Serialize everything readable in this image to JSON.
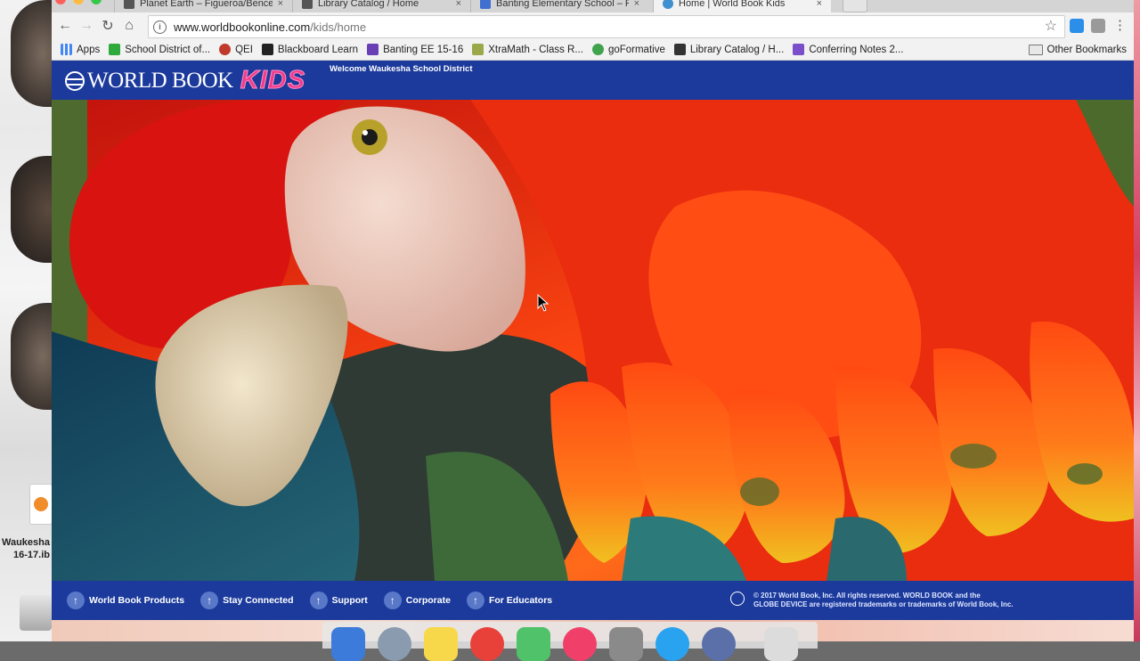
{
  "desktop": {
    "file_label_line1": "Waukesha",
    "file_label_line2": "16-17.ib"
  },
  "browser": {
    "tabs": [
      {
        "title": "Planet Earth – Figueroa/Bence",
        "active": false
      },
      {
        "title": "Library Catalog / Home",
        "active": false
      },
      {
        "title": "Banting Elementary School – F",
        "active": false
      },
      {
        "title": "Home | World Book Kids",
        "active": true
      }
    ],
    "tab_close_glyph": "×",
    "address": {
      "host": "www.worldbookonline.com",
      "path": "/kids/home"
    },
    "bookmarks": [
      {
        "label": "Apps",
        "icon": "apps-grid-icon",
        "color": "#4285f4"
      },
      {
        "label": "School District of...",
        "icon": "school-district-icon",
        "color": "#2eaa3d"
      },
      {
        "label": "QEI",
        "icon": "qei-icon",
        "color": "#c0392b"
      },
      {
        "label": "Blackboard Learn",
        "icon": "blackboard-icon",
        "color": "#222222"
      },
      {
        "label": "Banting EE 15-16",
        "icon": "banting-icon",
        "color": "#6a3fb5"
      },
      {
        "label": "XtraMath - Class R...",
        "icon": "xtramath-icon",
        "color": "#9aa84a"
      },
      {
        "label": "goFormative",
        "icon": "goformative-icon",
        "color": "#3fa34d"
      },
      {
        "label": "Library Catalog / H...",
        "icon": "library-catalog-icon",
        "color": "#333333"
      },
      {
        "label": "Conferring Notes 2...",
        "icon": "conferring-notes-icon",
        "color": "#7b4fc9"
      }
    ],
    "other_bookmarks": "Other Bookmarks"
  },
  "site": {
    "logo_world_book": "WORLD BOOK",
    "logo_kids": "KIDS",
    "welcome": "Welcome Waukesha School District",
    "footer_links": [
      "World Book Products",
      "Stay Connected",
      "Support",
      "Corporate",
      "For Educators"
    ],
    "copyright_line1": "© 2017 World Book, Inc. All rights reserved. WORLD BOOK and the",
    "copyright_line2": "GLOBE DEVICE are registered trademarks or trademarks of World Book, Inc.",
    "hero_image": "scarlet-macaw-photo"
  },
  "colors": {
    "brand_blue": "#1b3a9c",
    "kids_pink": "#f03c8c",
    "footer_arrow": "#5a78c8"
  }
}
